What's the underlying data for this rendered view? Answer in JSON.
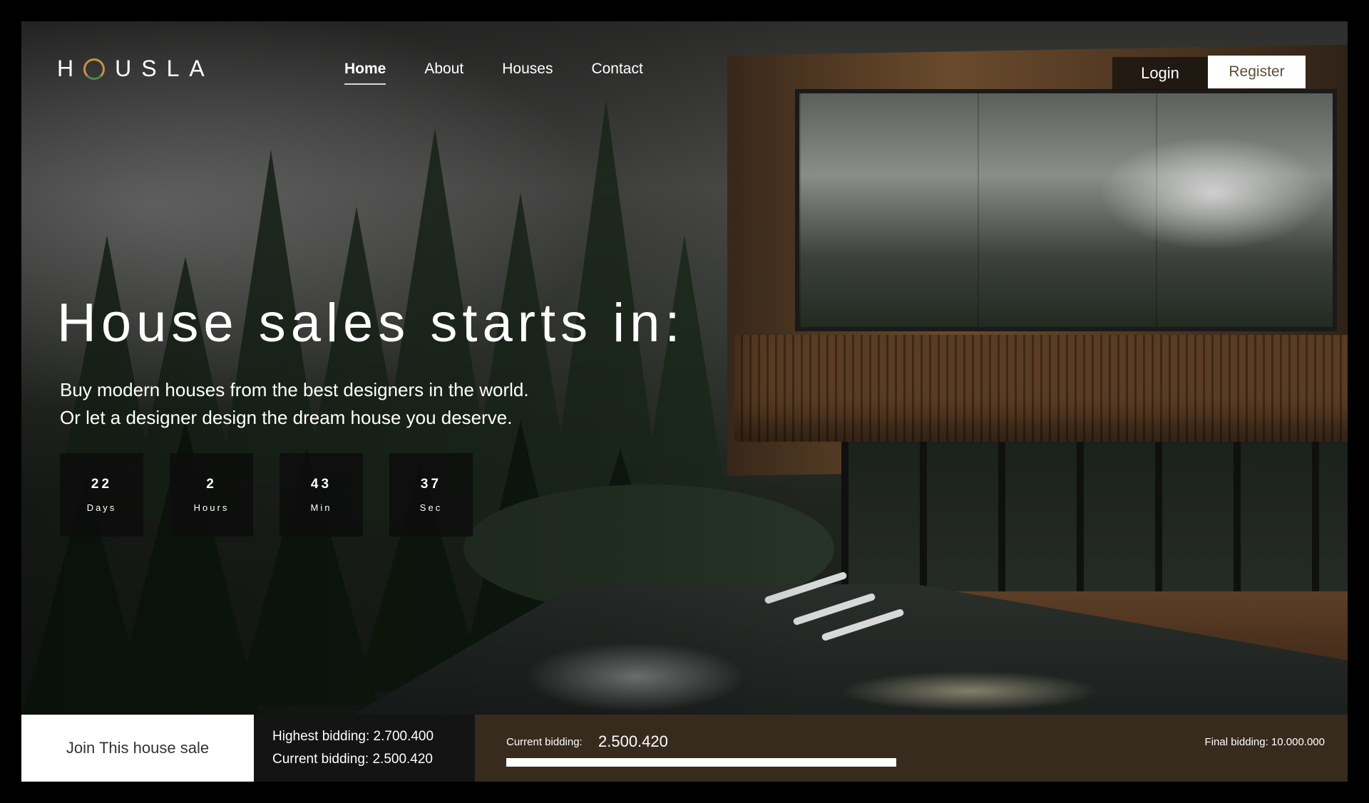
{
  "brand": {
    "logo_text": "H  USLA",
    "logo_accent_colors": [
      "#c99245",
      "#4d8a44"
    ]
  },
  "nav": {
    "items": [
      {
        "label": "Home",
        "active": true
      },
      {
        "label": "About",
        "active": false
      },
      {
        "label": "Houses",
        "active": false
      },
      {
        "label": "Contact",
        "active": false
      }
    ]
  },
  "auth": {
    "login_label": "Login",
    "register_label": "Register"
  },
  "hero": {
    "title": "House sales starts in:",
    "subtitle_line1": "Buy modern houses from the best designers in the world.",
    "subtitle_line2": "Or let a designer design the dream house you deserve."
  },
  "countdown": [
    {
      "value": "22",
      "unit": "Days"
    },
    {
      "value": "2",
      "unit": "Hours"
    },
    {
      "value": "43",
      "unit": "Min"
    },
    {
      "value": "37",
      "unit": "Sec"
    }
  ],
  "bidding": {
    "join_label": "Join This house sale",
    "highest_text": "Highest bidding: 2.700.400",
    "current_text": "Current bidding: 2.500.420",
    "current_label": "Current bidding:",
    "current_value": "2.500.420",
    "final_text": "Final bidding: 10.000.000",
    "progress_fraction": 0.476
  },
  "colors": {
    "bottom_panel": "#372b1e",
    "register_text": "#5d4e37"
  }
}
